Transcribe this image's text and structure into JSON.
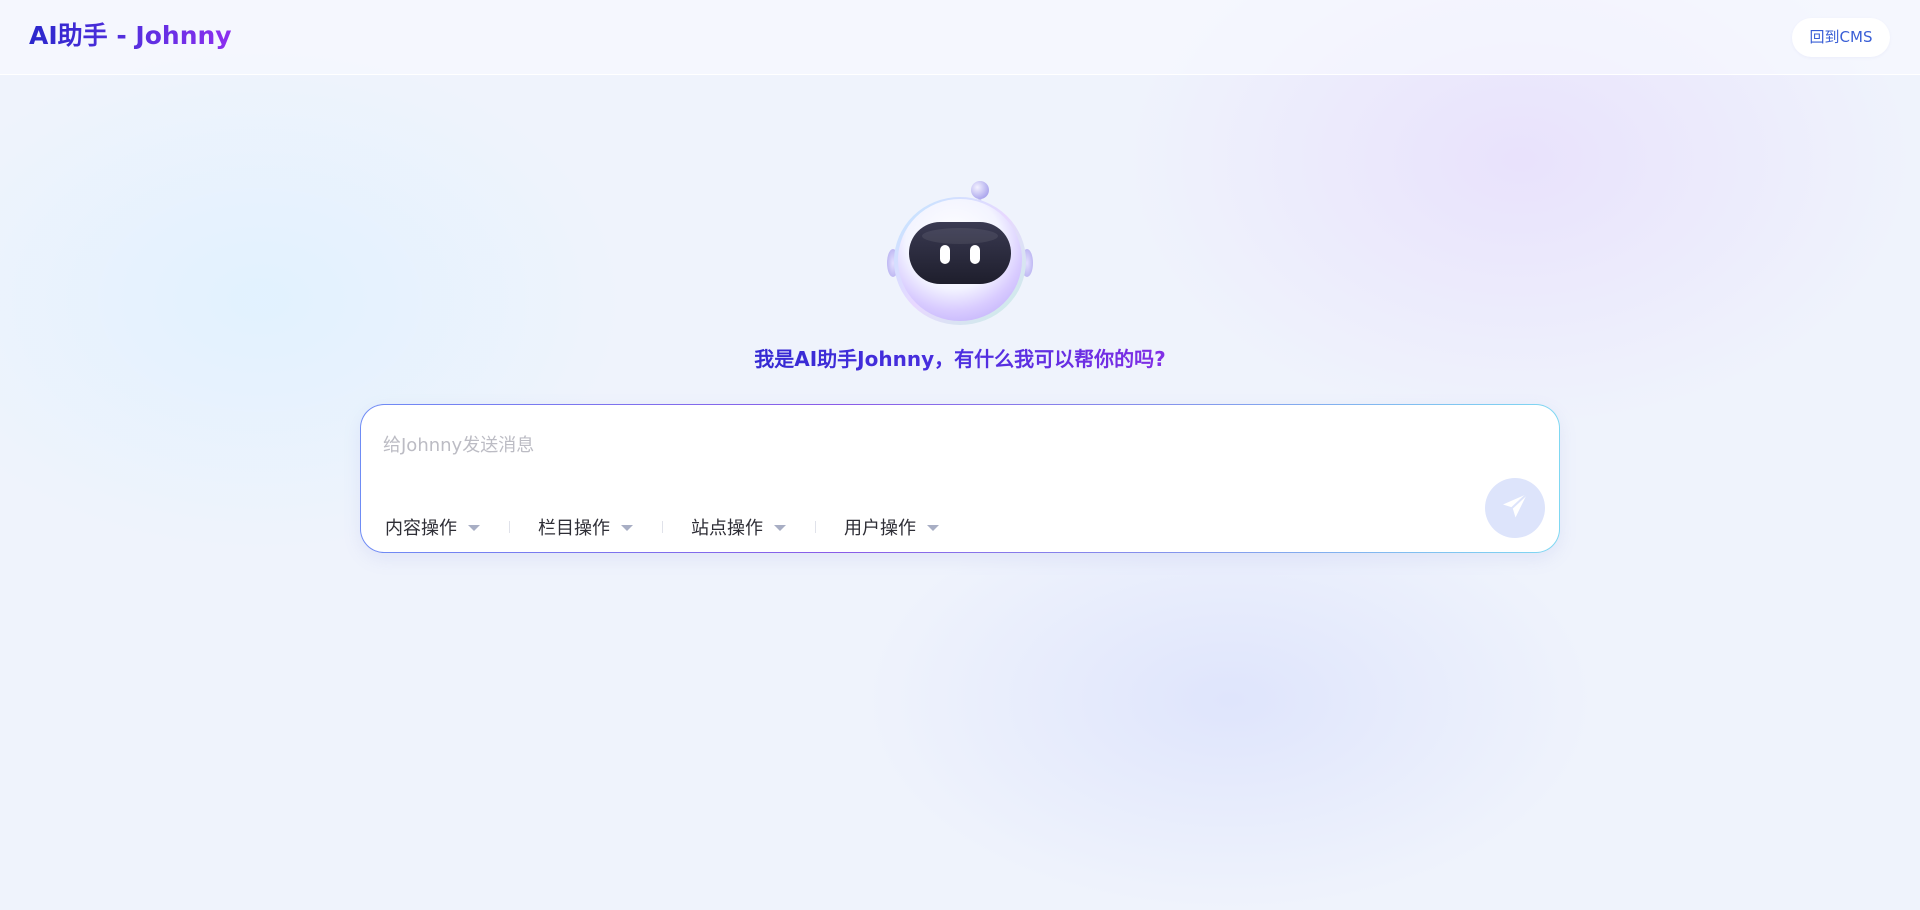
{
  "header": {
    "title": "AI助手 - Johnny",
    "back_button_label": "回到CMS"
  },
  "robot": {
    "icon": "robot-avatar-icon"
  },
  "greeting": "我是AI助手Johnny，有什么我可以帮你的吗?",
  "chat": {
    "input_value": "",
    "input_placeholder": "给Johnny发送消息",
    "menus": [
      {
        "label": "内容操作",
        "icon": "chevron-down-icon"
      },
      {
        "label": "栏目操作",
        "icon": "chevron-down-icon"
      },
      {
        "label": "站点操作",
        "icon": "chevron-down-icon"
      },
      {
        "label": "用户操作",
        "icon": "chevron-down-icon"
      }
    ],
    "send_icon": "send-icon"
  },
  "colors": {
    "brand_start": "#2a27cc",
    "brand_end": "#9a2ee8",
    "send_button_bg": "#dde4fb",
    "back_button_text": "#3a5fd6"
  }
}
